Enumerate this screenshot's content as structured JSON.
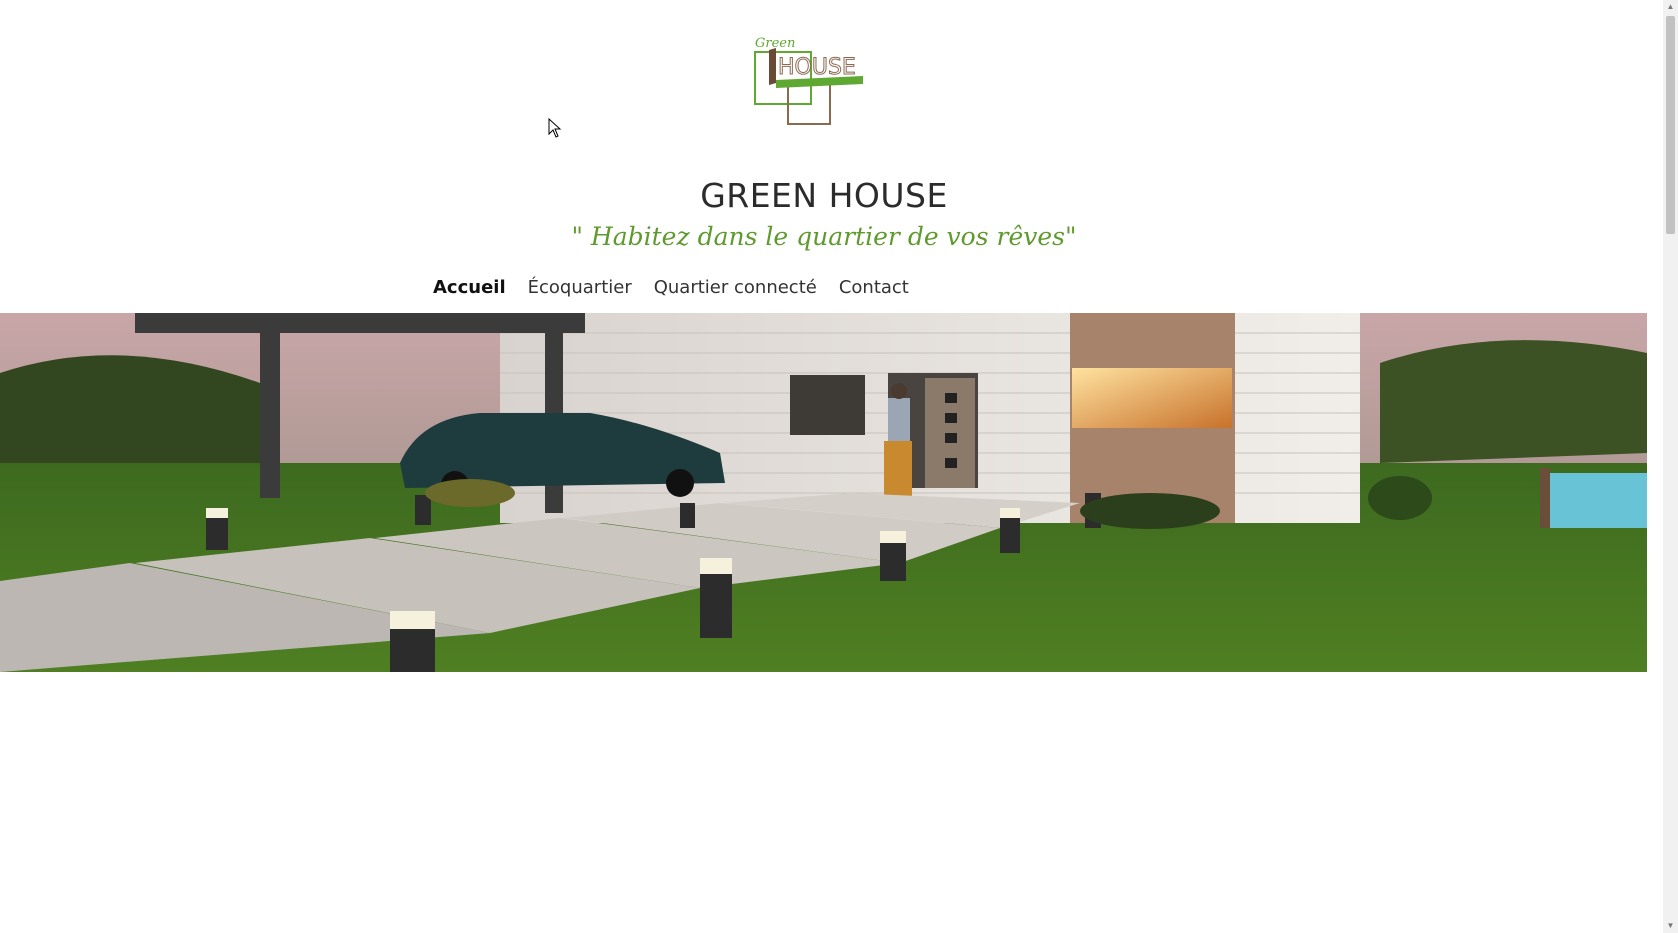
{
  "logo": {
    "script_text": "Green",
    "text": "HOUSE",
    "icon": "green-house-logo"
  },
  "site": {
    "title": "GREEN HOUSE",
    "tagline": "\" Habitez dans le quartier de vos rêves\""
  },
  "nav": {
    "items": [
      {
        "label": "Accueil",
        "active": true
      },
      {
        "label": "Écoquartier",
        "active": false
      },
      {
        "label": "Quartier connecté",
        "active": false
      },
      {
        "label": "Contact",
        "active": false
      }
    ]
  },
  "hero": {
    "icon": "house-garden-photo"
  },
  "colors": {
    "brand_green": "#5fa832",
    "brand_brown": "#8b6a52",
    "title": "#2b2b2b"
  }
}
